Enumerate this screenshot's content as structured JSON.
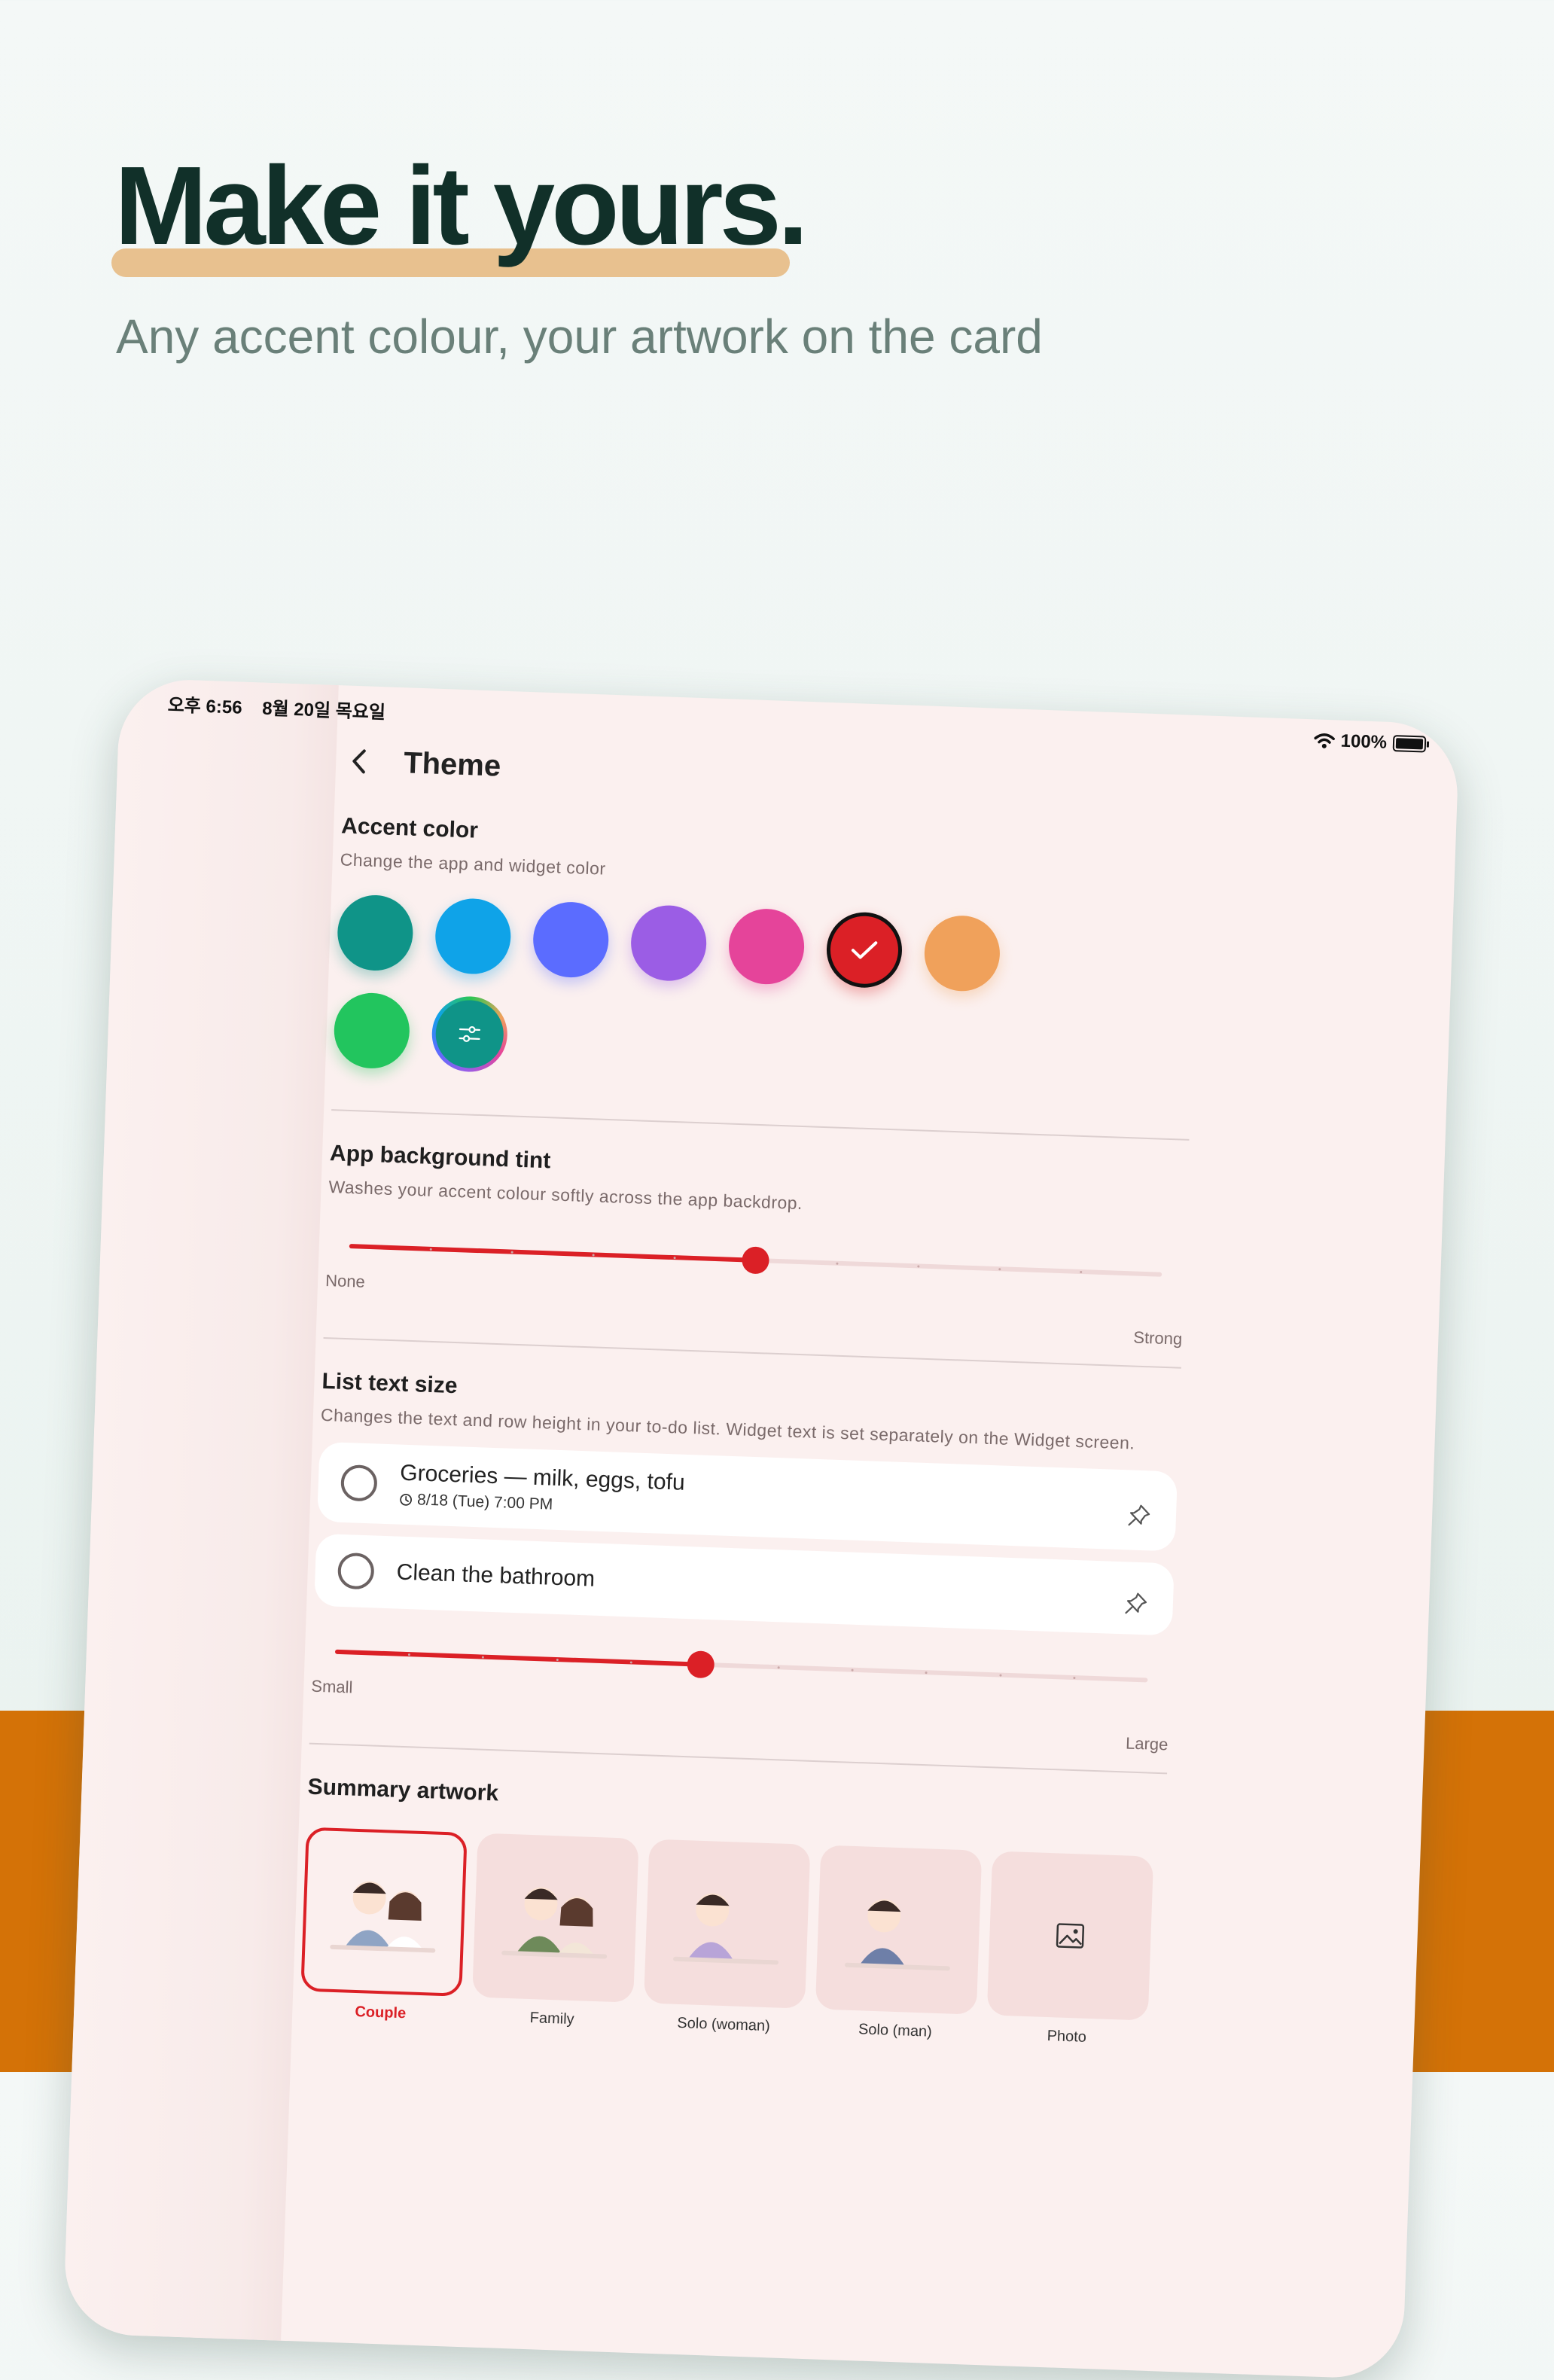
{
  "hero": {
    "title": "Make it yours.",
    "subtitle": "Any accent colour, your artwork on the card"
  },
  "status_bar": {
    "time": "오후 6:56",
    "date": "8월 20일 목요일",
    "battery": "100%",
    "icons": [
      "wifi-icon",
      "battery-icon"
    ]
  },
  "header": {
    "title": "Theme",
    "back_icon": "chevron-left-icon"
  },
  "accent": {
    "title": "Accent color",
    "desc": "Change the app and widget color",
    "colors": [
      "#0f9488",
      "#0fa3e8",
      "#5b6cff",
      "#9b5de5",
      "#e5449a",
      "#db2026",
      "#f0a15b",
      "#22c55e"
    ],
    "selected_index": 5,
    "custom_icon": "sliders-icon",
    "check_icon": "check-icon"
  },
  "tint": {
    "title": "App background tint",
    "desc": "Washes your accent colour softly across the app backdrop.",
    "min_label": "None",
    "max_label": "Strong",
    "value": 0.5,
    "steps": 10
  },
  "text_size": {
    "title": "List text size",
    "desc": "Changes the text and row height in your to-do list. Widget text is set separately on the Widget screen.",
    "items": [
      {
        "title": "Groceries — milk, eggs, tofu",
        "meta": "8/18 (Tue) 7:00 PM"
      },
      {
        "title": "Clean the bathroom",
        "meta": ""
      }
    ],
    "min_label": "Small",
    "max_label": "Large",
    "value": 0.45,
    "steps": 11
  },
  "artwork": {
    "title": "Summary artwork",
    "options": [
      "Couple",
      "Family",
      "Solo (woman)",
      "Solo (man)",
      "Photo"
    ],
    "selected_index": 0,
    "photo_icon": "image-icon"
  },
  "colors": {
    "accent": "#db2026",
    "hero_title": "#113029",
    "hero_underline": "#e8c18f",
    "band": "#d47207"
  }
}
